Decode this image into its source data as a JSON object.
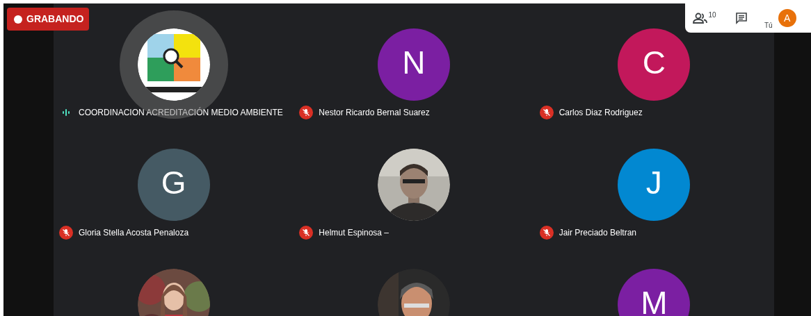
{
  "recording": {
    "label": "GRABANDO",
    "on": true
  },
  "toolbar": {
    "participant_count": "10",
    "self_label": "Tú",
    "self_initial": "A"
  },
  "tiles": [
    {
      "name": "COORDINACION ACREDITACIÓN MEDIO AMBIENTE",
      "kind": "picture",
      "muted": false,
      "speaking": true
    },
    {
      "name": "Nestor Ricardo Bernal Suarez",
      "kind": "initial",
      "initial": "N",
      "color": "#7b1fa2",
      "muted": true
    },
    {
      "name": "Carlos Diaz Rodriguez",
      "kind": "initial",
      "initial": "C",
      "color": "#c2185b",
      "muted": true
    },
    {
      "name": "Gloria Stella Acosta Penaloza",
      "kind": "initial",
      "initial": "G",
      "color": "#455a64",
      "muted": true
    },
    {
      "name": "Helmut Espinosa –",
      "kind": "picture",
      "muted": true
    },
    {
      "name": "Jair Preciado Beltran",
      "kind": "initial",
      "initial": "J",
      "color": "#0288d1",
      "muted": true
    },
    {
      "kind": "picture"
    },
    {
      "kind": "picture"
    },
    {
      "kind": "initial",
      "initial": "M",
      "color": "#7b1fa2"
    }
  ]
}
